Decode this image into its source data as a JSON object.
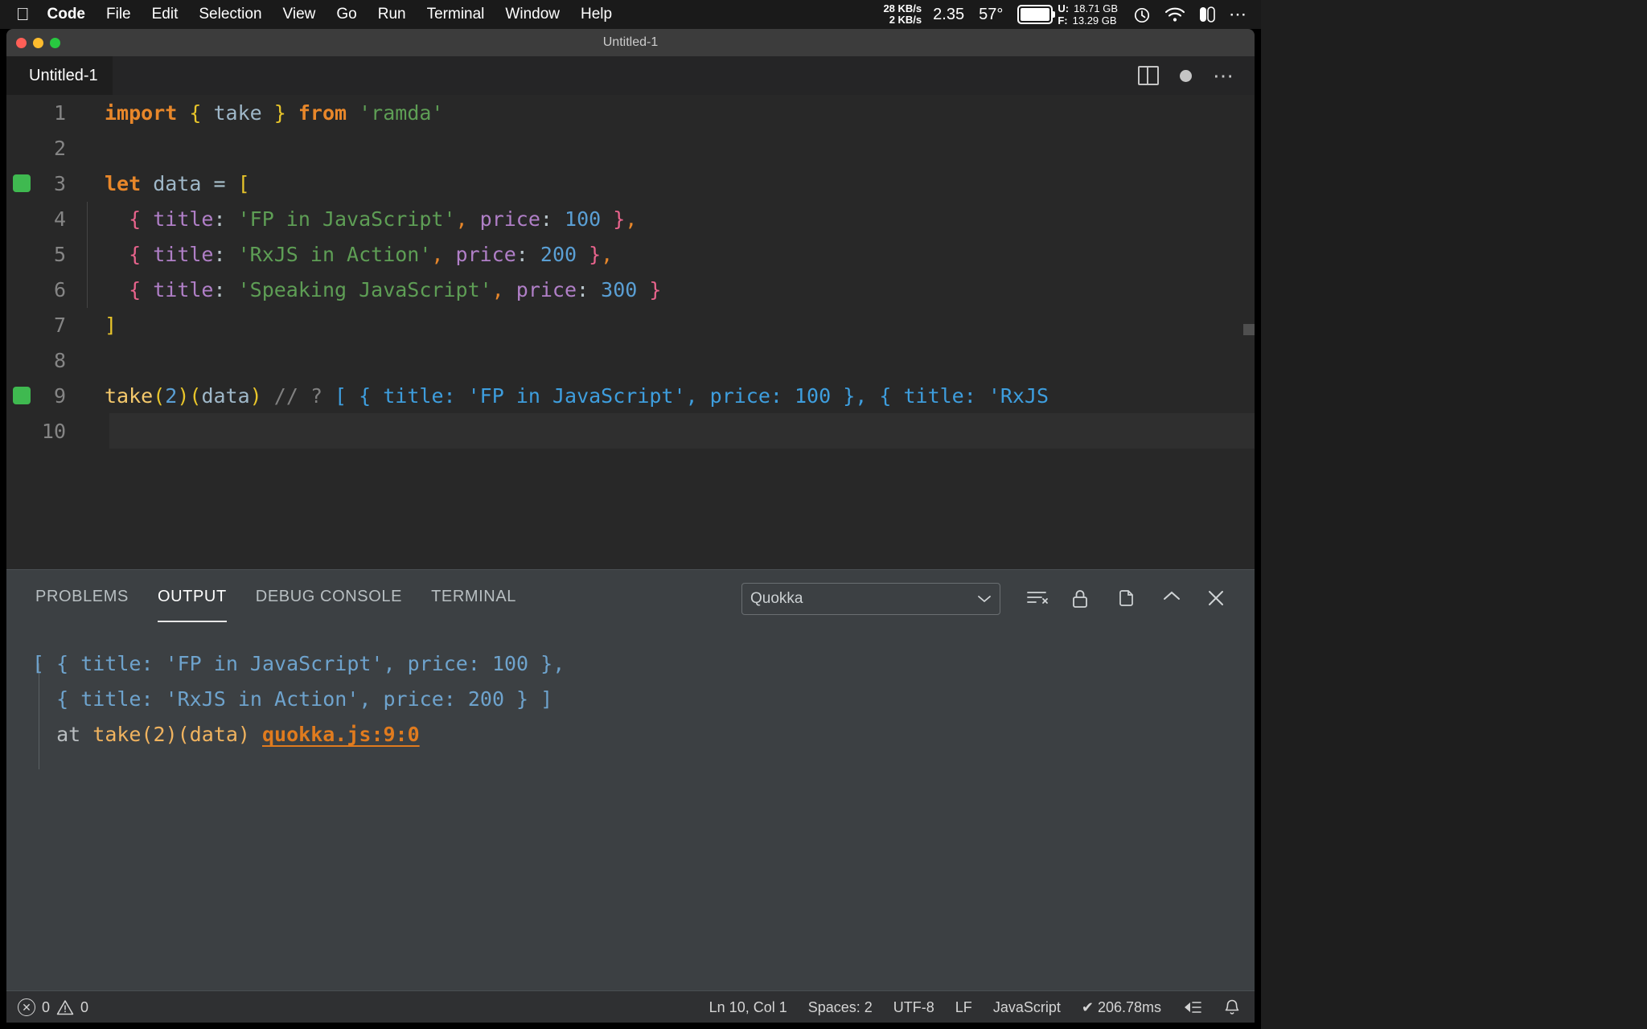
{
  "menubar": {
    "apple_icon": "apple-logo",
    "items": [
      {
        "label": "Code",
        "bold": true
      },
      {
        "label": "File",
        "bold": false
      },
      {
        "label": "Edit",
        "bold": false
      },
      {
        "label": "Selection",
        "bold": false
      },
      {
        "label": "View",
        "bold": false
      },
      {
        "label": "Go",
        "bold": false
      },
      {
        "label": "Run",
        "bold": false
      },
      {
        "label": "Terminal",
        "bold": false
      },
      {
        "label": "Window",
        "bold": false
      },
      {
        "label": "Help",
        "bold": false
      }
    ],
    "net_up": "28 KB/s",
    "net_down": "2 KB/s",
    "cpu_load": "2.35",
    "temperature": "57°",
    "battery_icon": "battery-icon",
    "mem_used_label": "U:",
    "mem_used_value": "18.71 GB",
    "mem_free_label": "F:",
    "mem_free_value": "13.29 GB",
    "timer_icon": "stopwatch-icon",
    "wifi_icon": "wifi-icon",
    "control_center_icon": "control-center-icon",
    "menu_extras_icon": "ellipsis-icon"
  },
  "window": {
    "title": "Untitled-1",
    "close_label": "close",
    "minimize_label": "minimize",
    "zoom_label": "zoom"
  },
  "editor": {
    "tab_label": "Untitled-1",
    "split_editor_icon": "split-editor-icon",
    "unsaved_dot_icon": "unsaved-dot-icon",
    "more_actions_icon": "more-actions-icon",
    "lines": [
      {
        "num": "1",
        "run": false,
        "indent": false,
        "current": false
      },
      {
        "num": "2",
        "run": false,
        "indent": false,
        "current": false
      },
      {
        "num": "3",
        "run": true,
        "indent": false,
        "current": false
      },
      {
        "num": "4",
        "run": false,
        "indent": true,
        "current": false
      },
      {
        "num": "5",
        "run": false,
        "indent": true,
        "current": false
      },
      {
        "num": "6",
        "run": false,
        "indent": true,
        "current": false
      },
      {
        "num": "7",
        "run": false,
        "indent": false,
        "current": false
      },
      {
        "num": "8",
        "run": false,
        "indent": false,
        "current": false
      },
      {
        "num": "9",
        "run": true,
        "indent": false,
        "current": false
      },
      {
        "num": "10",
        "run": false,
        "indent": false,
        "current": true
      }
    ],
    "code": {
      "l1_import": "import",
      "l1_brace_open": " { ",
      "l1_take": "take",
      "l1_brace_close": " } ",
      "l1_from": "from",
      "l1_module": " 'ramda'",
      "l3_let": "let",
      "l3_data": " data ",
      "l3_eq": "= ",
      "l3_bracket": "[",
      "l4_curly_open": "{ ",
      "l4_title": "title",
      "l4_colon": ": ",
      "l4_str": "'FP in JavaScript'",
      "l4_comma": ", ",
      "l4_price": "price",
      "l4_colon2": ": ",
      "l4_num": "100",
      "l4_curly_close": " }",
      "l4_tail": ",",
      "l5_str": "'RxJS in Action'",
      "l5_num": "200",
      "l6_str": "'Speaking JavaScript'",
      "l6_num": "300",
      "l7_bracket": "]",
      "l9_take": "take",
      "l9_paren1": "(",
      "l9_num2": "2",
      "l9_paren2": ")(",
      "l9_data": "data",
      "l9_paren3": ")",
      "l9_comment": " // ?",
      "l9_result": " [ { title: 'FP in JavaScript', price: 100 }, { title: 'RxJS"
    }
  },
  "panel": {
    "tabs": [
      {
        "label": "PROBLEMS",
        "active": false
      },
      {
        "label": "OUTPUT",
        "active": true
      },
      {
        "label": "DEBUG CONSOLE",
        "active": false
      },
      {
        "label": "TERMINAL",
        "active": false
      }
    ],
    "channel_select_value": "Quokka",
    "channel_select_chevron": "chevron-down-icon",
    "actions": [
      {
        "name": "clear-output-icon"
      },
      {
        "name": "lock-scroll-icon"
      },
      {
        "name": "open-in-editor-icon"
      },
      {
        "name": "maximize-panel-icon"
      },
      {
        "name": "close-panel-icon"
      }
    ],
    "output": {
      "line1_a": "[ { title: 'FP in JavaScript', price: 100 },",
      "line2_a": "  { title: 'RxJS in Action', price: 200 } ]",
      "line3_at": "  at ",
      "line3_fn": "take(2)(data) ",
      "line3_link": "quokka.js:9:0"
    }
  },
  "statusbar": {
    "error_icon": "error-circle-icon",
    "error_count": "0",
    "warning_icon": "warning-triangle-icon",
    "warning_count": "0",
    "cursor_position": "Ln 10, Col 1",
    "indentation": "Spaces: 2",
    "encoding": "UTF-8",
    "eol": "LF",
    "language_mode": "JavaScript",
    "quokka_time": "✔ 206.78ms",
    "remote_icon": "remote-window-icon",
    "bell_icon": "notifications-bell-icon"
  },
  "colors": {
    "accent_green": "#3fb950",
    "keyword": "#e8872a",
    "string": "#5e9e55",
    "number": "#5a9fd4",
    "property": "#b07fc7",
    "bracket": "#e8c52a",
    "curly": "#e8638c",
    "quokka_inline": "#3e9ede",
    "link_orange": "#e07b1e"
  }
}
